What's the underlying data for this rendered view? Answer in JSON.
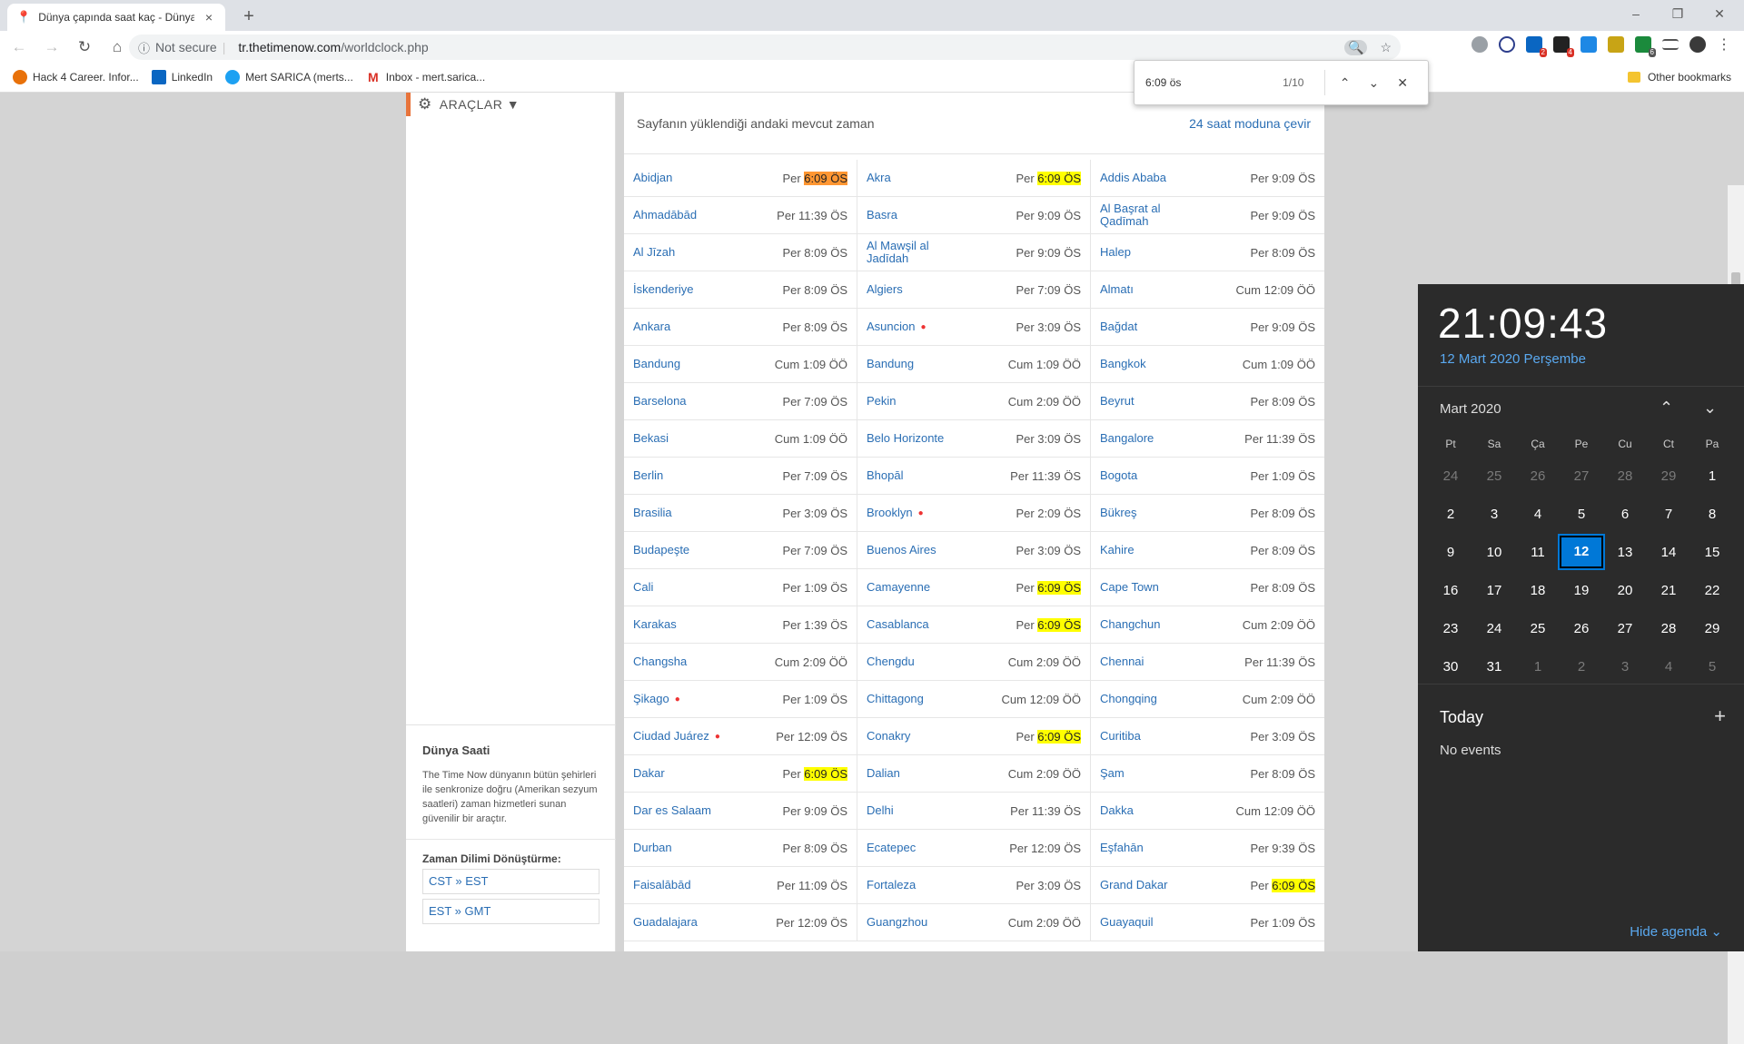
{
  "browser": {
    "tab_title": "Dünya çapında saat kaç - Dünya",
    "tab_close": "×",
    "new_tab": "+",
    "window_buttons": [
      "–",
      "❐",
      "✕"
    ],
    "security": "Not secure",
    "url_host": "tr.thetimenow.com",
    "url_path": "/worldclock.php",
    "bookmarks": [
      {
        "label": "Hack 4 Career. Infor...",
        "color": "#e8710a"
      },
      {
        "label": "LinkedIn",
        "color": "#0a66c2"
      },
      {
        "label": "Mert SARICA (merts...",
        "color": "#1da1f2"
      },
      {
        "label": "Inbox - mert.sarica...",
        "color": "#d93025"
      }
    ],
    "other_bookmarks": "Other bookmarks",
    "ext_badges": [
      "2",
      "4",
      "6"
    ]
  },
  "find": {
    "query": "6:09 ös",
    "count": "1/10",
    "prev": "⌃",
    "next": "⌄",
    "close": "✕"
  },
  "left": {
    "tools": "ARAÇLAR ▼",
    "box_title": "Dünya Saati",
    "box_text": "The Time Now dünyanın bütün şehirleri ile senkronize doğru (Amerikan sezyum saatleri) zaman hizmetleri sunan güvenilir bir araçtır.",
    "converter_title": "Zaman Dilimi Dönüştürme:",
    "converters": [
      "CST » EST",
      "EST » GMT"
    ]
  },
  "main": {
    "header_text": "Sayfanın yüklendiği andaki mevcut zaman",
    "header_link": "24 saat moduna çevir",
    "rows": [
      [
        {
          "city": "Abidjan",
          "day": "Per",
          "time": "6:09 ÖS",
          "hl": "cur"
        },
        {
          "city": "Akra",
          "day": "Per",
          "time": "6:09 ÖS",
          "hl": "yes"
        },
        {
          "city": "Addis Ababa",
          "day": "Per",
          "time": "9:09 ÖS"
        }
      ],
      [
        {
          "city": "Ahmadābād",
          "day": "Per",
          "time": "11:39 ÖS"
        },
        {
          "city": "Basra",
          "day": "Per",
          "time": "9:09 ÖS"
        },
        {
          "city": "Al Başrat al Qadīmah",
          "day": "Per",
          "time": "9:09 ÖS"
        }
      ],
      [
        {
          "city": "Al Jīzah",
          "day": "Per",
          "time": "8:09 ÖS"
        },
        {
          "city": "Al Mawşil al Jadīdah",
          "day": "Per",
          "time": "9:09 ÖS"
        },
        {
          "city": "Halep",
          "day": "Per",
          "time": "8:09 ÖS"
        }
      ],
      [
        {
          "city": "İskenderiye",
          "day": "Per",
          "time": "8:09 ÖS"
        },
        {
          "city": "Algiers",
          "day": "Per",
          "time": "7:09 ÖS"
        },
        {
          "city": "Almatı",
          "day": "Cum",
          "time": "12:09 ÖÖ"
        }
      ],
      [
        {
          "city": "Ankara",
          "day": "Per",
          "time": "8:09 ÖS"
        },
        {
          "city": "Asuncion",
          "dot": true,
          "day": "Per",
          "time": "3:09 ÖS"
        },
        {
          "city": "Bağdat",
          "day": "Per",
          "time": "9:09 ÖS"
        }
      ],
      [
        {
          "city": "Bandung",
          "day": "Cum",
          "time": "1:09 ÖÖ"
        },
        {
          "city": "Bandung",
          "day": "Cum",
          "time": "1:09 ÖÖ"
        },
        {
          "city": "Bangkok",
          "day": "Cum",
          "time": "1:09 ÖÖ"
        }
      ],
      [
        {
          "city": "Barselona",
          "day": "Per",
          "time": "7:09 ÖS"
        },
        {
          "city": "Pekin",
          "day": "Cum",
          "time": "2:09 ÖÖ"
        },
        {
          "city": "Beyrut",
          "day": "Per",
          "time": "8:09 ÖS"
        }
      ],
      [
        {
          "city": "Bekasi",
          "day": "Cum",
          "time": "1:09 ÖÖ"
        },
        {
          "city": "Belo Horizonte",
          "day": "Per",
          "time": "3:09 ÖS"
        },
        {
          "city": "Bangalore",
          "day": "Per",
          "time": "11:39 ÖS"
        }
      ],
      [
        {
          "city": "Berlin",
          "day": "Per",
          "time": "7:09 ÖS"
        },
        {
          "city": "Bhopāl",
          "day": "Per",
          "time": "11:39 ÖS"
        },
        {
          "city": "Bogota",
          "day": "Per",
          "time": "1:09 ÖS"
        }
      ],
      [
        {
          "city": "Brasilia",
          "day": "Per",
          "time": "3:09 ÖS"
        },
        {
          "city": "Brooklyn",
          "dot": true,
          "day": "Per",
          "time": "2:09 ÖS"
        },
        {
          "city": "Bükreş",
          "day": "Per",
          "time": "8:09 ÖS"
        }
      ],
      [
        {
          "city": "Budapeşte",
          "day": "Per",
          "time": "7:09 ÖS"
        },
        {
          "city": "Buenos Aires",
          "day": "Per",
          "time": "3:09 ÖS"
        },
        {
          "city": "Kahire",
          "day": "Per",
          "time": "8:09 ÖS"
        }
      ],
      [
        {
          "city": "Cali",
          "day": "Per",
          "time": "1:09 ÖS"
        },
        {
          "city": "Camayenne",
          "day": "Per",
          "time": "6:09 ÖS",
          "hl": "yes"
        },
        {
          "city": "Cape Town",
          "day": "Per",
          "time": "8:09 ÖS"
        }
      ],
      [
        {
          "city": "Karakas",
          "day": "Per",
          "time": "1:39 ÖS"
        },
        {
          "city": "Casablanca",
          "day": "Per",
          "time": "6:09 ÖS",
          "hl": "yes"
        },
        {
          "city": "Changchun",
          "day": "Cum",
          "time": "2:09 ÖÖ"
        }
      ],
      [
        {
          "city": "Changsha",
          "day": "Cum",
          "time": "2:09 ÖÖ"
        },
        {
          "city": "Chengdu",
          "day": "Cum",
          "time": "2:09 ÖÖ"
        },
        {
          "city": "Chennai",
          "day": "Per",
          "time": "11:39 ÖS"
        }
      ],
      [
        {
          "city": "Şikago",
          "dot": true,
          "day": "Per",
          "time": "1:09 ÖS"
        },
        {
          "city": "Chittagong",
          "day": "Cum",
          "time": "12:09 ÖÖ"
        },
        {
          "city": "Chongqing",
          "day": "Cum",
          "time": "2:09 ÖÖ"
        }
      ],
      [
        {
          "city": "Ciudad Juárez",
          "dot": true,
          "day": "Per",
          "time": "12:09 ÖS"
        },
        {
          "city": "Conakry",
          "day": "Per",
          "time": "6:09 ÖS",
          "hl": "yes"
        },
        {
          "city": "Curitiba",
          "day": "Per",
          "time": "3:09 ÖS"
        }
      ],
      [
        {
          "city": "Dakar",
          "day": "Per",
          "time": "6:09 ÖS",
          "hl": "yes"
        },
        {
          "city": "Dalian",
          "day": "Cum",
          "time": "2:09 ÖÖ"
        },
        {
          "city": "Şam",
          "day": "Per",
          "time": "8:09 ÖS"
        }
      ],
      [
        {
          "city": "Dar es Salaam",
          "day": "Per",
          "time": "9:09 ÖS"
        },
        {
          "city": "Delhi",
          "day": "Per",
          "time": "11:39 ÖS"
        },
        {
          "city": "Dakka",
          "day": "Cum",
          "time": "12:09 ÖÖ"
        }
      ],
      [
        {
          "city": "Durban",
          "day": "Per",
          "time": "8:09 ÖS"
        },
        {
          "city": "Ecatepec",
          "day": "Per",
          "time": "12:09 ÖS"
        },
        {
          "city": "Eşfahān",
          "day": "Per",
          "time": "9:39 ÖS"
        }
      ],
      [
        {
          "city": "Faisalābād",
          "day": "Per",
          "time": "11:09 ÖS"
        },
        {
          "city": "Fortaleza",
          "day": "Per",
          "time": "3:09 ÖS"
        },
        {
          "city": "Grand Dakar",
          "day": "Per",
          "time": "6:09 ÖS",
          "hl": "yes"
        }
      ],
      [
        {
          "city": "Guadalajara",
          "day": "Per",
          "time": "12:09 ÖS"
        },
        {
          "city": "Guangzhou",
          "day": "Cum",
          "time": "2:09 ÖÖ"
        },
        {
          "city": "Guayaquil",
          "day": "Per",
          "time": "1:09 ÖS"
        }
      ]
    ]
  },
  "calendar": {
    "time": "21:09:43",
    "date": "12 Mart 2020 Perşembe",
    "month": "Mart 2020",
    "nav_up": "⌃",
    "nav_down": "⌄",
    "weekdays": [
      "Pt",
      "Sa",
      "Ça",
      "Pe",
      "Cu",
      "Ct",
      "Pa"
    ],
    "weeks": [
      [
        [
          "24",
          1
        ],
        [
          "25",
          1
        ],
        [
          "26",
          1
        ],
        [
          "27",
          1
        ],
        [
          "28",
          1
        ],
        [
          "29",
          1
        ],
        [
          "1",
          0
        ]
      ],
      [
        [
          "2",
          0
        ],
        [
          "3",
          0
        ],
        [
          "4",
          0
        ],
        [
          "5",
          0
        ],
        [
          "6",
          0
        ],
        [
          "7",
          0
        ],
        [
          "8",
          0
        ]
      ],
      [
        [
          "9",
          0
        ],
        [
          "10",
          0
        ],
        [
          "11",
          0
        ],
        [
          "12",
          2
        ],
        [
          "13",
          0
        ],
        [
          "14",
          0
        ],
        [
          "15",
          0
        ]
      ],
      [
        [
          "16",
          0
        ],
        [
          "17",
          0
        ],
        [
          "18",
          0
        ],
        [
          "19",
          0
        ],
        [
          "20",
          0
        ],
        [
          "21",
          0
        ],
        [
          "22",
          0
        ]
      ],
      [
        [
          "23",
          0
        ],
        [
          "24",
          0
        ],
        [
          "25",
          0
        ],
        [
          "26",
          0
        ],
        [
          "27",
          0
        ],
        [
          "28",
          0
        ],
        [
          "29",
          0
        ]
      ],
      [
        [
          "30",
          0
        ],
        [
          "31",
          0
        ],
        [
          "1",
          1
        ],
        [
          "2",
          1
        ],
        [
          "3",
          1
        ],
        [
          "4",
          1
        ],
        [
          "5",
          1
        ]
      ]
    ],
    "today_label": "Today",
    "add": "+",
    "no_events": "No events",
    "hide_agenda": "Hide agenda ⌄"
  }
}
